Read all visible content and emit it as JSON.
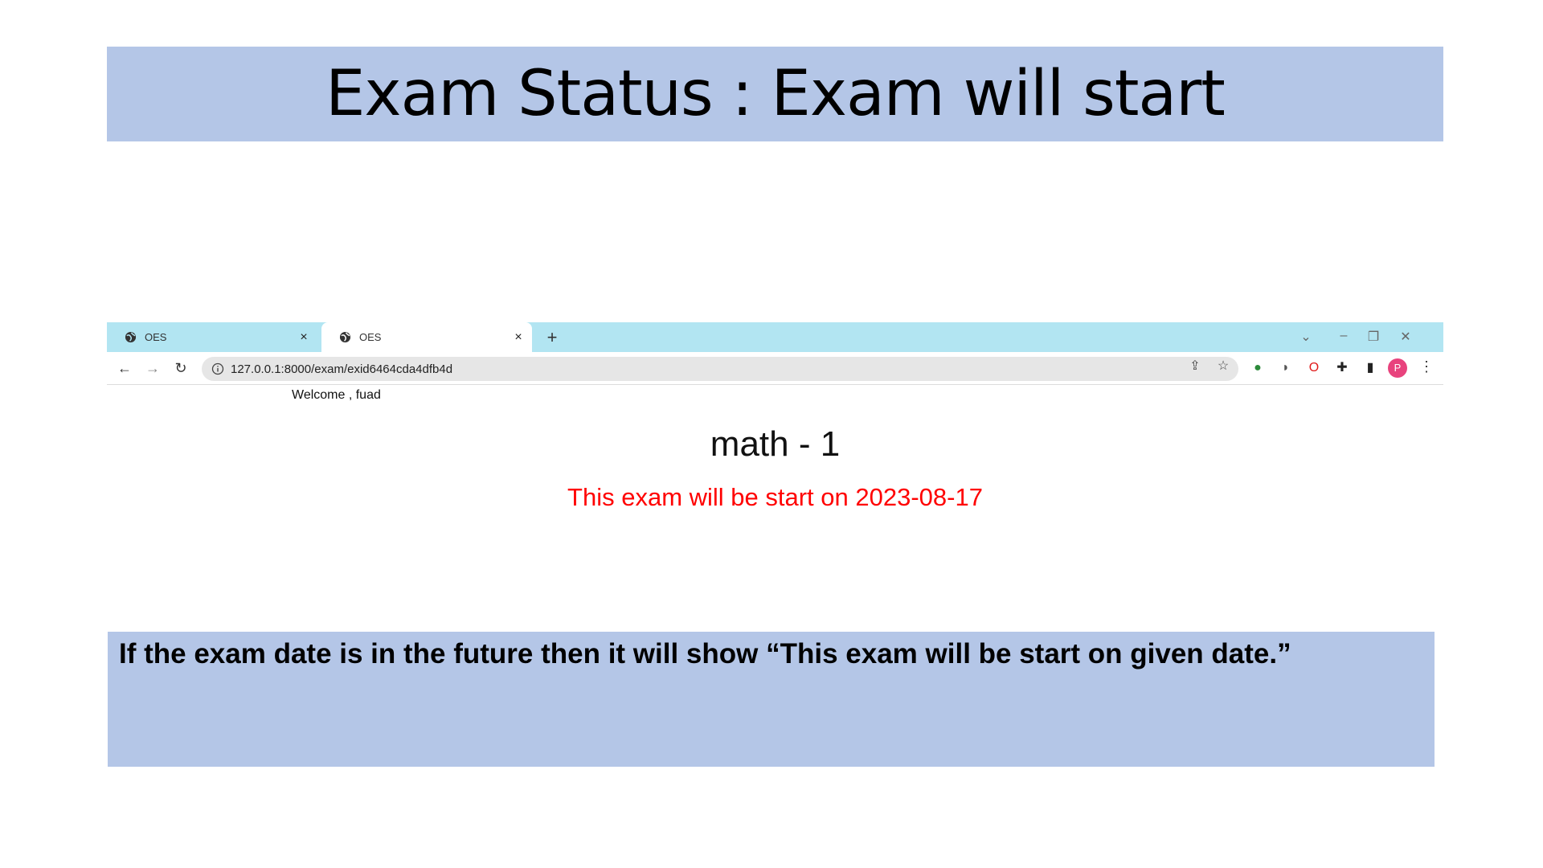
{
  "slide": {
    "title": "Exam Status : Exam will start",
    "note": "If the exam date is in the future then it will show “This exam will be start on given date.”"
  },
  "browser": {
    "tabs": [
      {
        "title": "OES",
        "icon": "globe-icon",
        "active": false
      },
      {
        "title": "OES",
        "icon": "globe-icon",
        "active": true
      }
    ],
    "url": "127.0.0.1:8000/exam/exid6464cda4dfb4d",
    "profile_initial": "P",
    "colors": {
      "tabbar": "#b2e5f2",
      "avatar": "#e8437d"
    }
  },
  "page": {
    "welcome": "Welcome , fuad",
    "exam_name": "math - 1",
    "message": "This exam will be start on 2023-08-17",
    "message_color": "#ff0000"
  }
}
